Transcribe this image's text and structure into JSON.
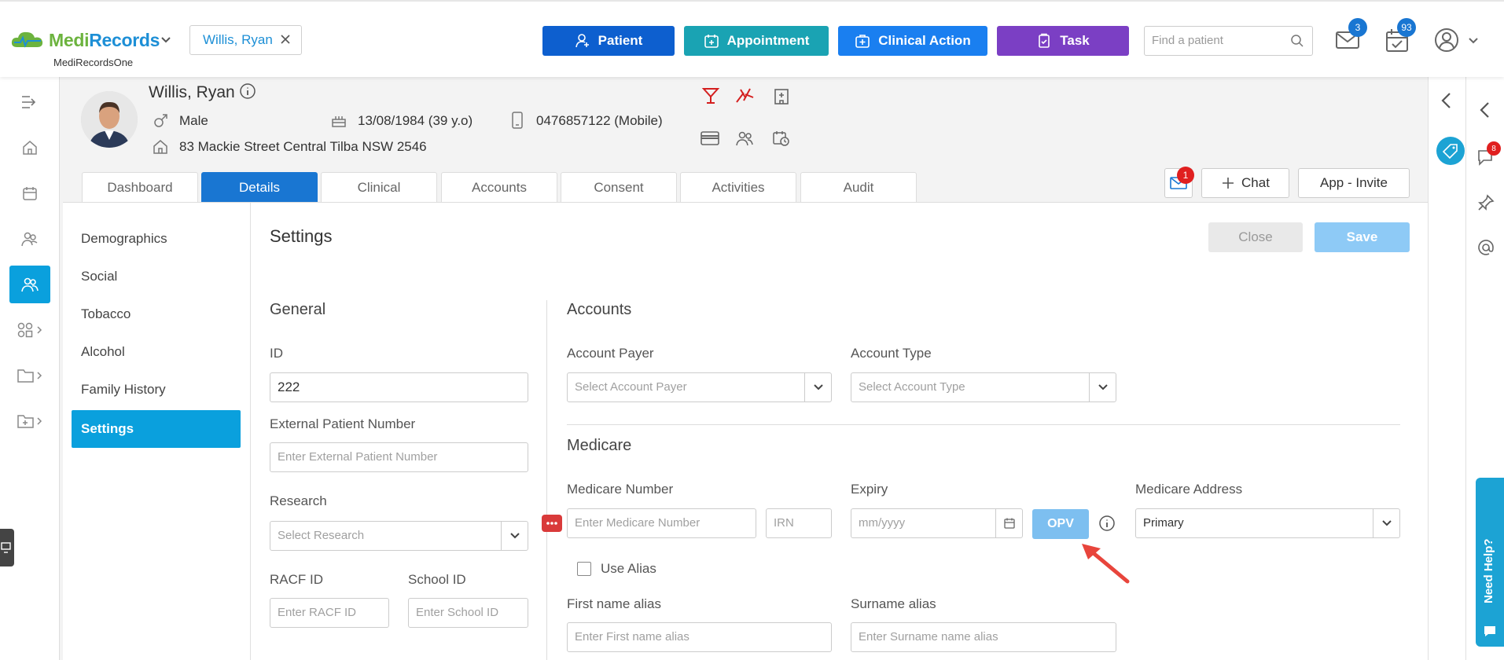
{
  "app": {
    "brand_medi": "Medi",
    "brand_records": "Records",
    "sub": "MediRecordsOne"
  },
  "header": {
    "patient_chip": "Willis, Ryan",
    "buttons": {
      "patient": "Patient",
      "appointment": "Appointment",
      "clinical_action": "Clinical Action",
      "task": "Task"
    },
    "search_placeholder": "Find a patient",
    "mail_badge": "3",
    "tasks_badge": "93",
    "colors": {
      "patient": "#0d5fcf",
      "appointment": "#1aa3b3",
      "clinical_action": "#1a7ff0",
      "task": "#7b3fc4"
    }
  },
  "patient": {
    "name": "Willis, Ryan",
    "gender": "Male",
    "dob": "13/08/1984 (39 y.o)",
    "phone": "0476857122 (Mobile)",
    "address": "83 Mackie Street Central Tilba NSW 2546"
  },
  "tabs": [
    "Dashboard",
    "Details",
    "Clinical",
    "Accounts",
    "Consent",
    "Activities",
    "Audit"
  ],
  "active_tab": "Details",
  "actions": {
    "message_badge": "1",
    "chat": "Chat",
    "app_invite": "App - Invite"
  },
  "menu": [
    "Demographics",
    "Social",
    "Tobacco",
    "Alcohol",
    "Family History",
    "Settings"
  ],
  "active_menu": "Settings",
  "settings": {
    "title": "Settings",
    "close": "Close",
    "save": "Save",
    "general": {
      "title": "General",
      "id_label": "ID",
      "id_value": "222",
      "ext_label": "External Patient Number",
      "ext_placeholder": "Enter External Patient Number",
      "research_label": "Research",
      "research_placeholder": "Select Research",
      "racf_label": "RACF ID",
      "racf_placeholder": "Enter RACF ID",
      "school_label": "School ID",
      "school_placeholder": "Enter School ID"
    },
    "accounts": {
      "title": "Accounts",
      "payer_label": "Account Payer",
      "payer_placeholder": "Select Account Payer",
      "type_label": "Account Type",
      "type_placeholder": "Select Account Type"
    },
    "medicare": {
      "title": "Medicare",
      "number_label": "Medicare Number",
      "number_placeholder": "Enter Medicare Number",
      "irn_placeholder": "IRN",
      "expiry_label": "Expiry",
      "expiry_placeholder": "mm/yyyy",
      "opv": "OPV",
      "address_label": "Medicare Address",
      "address_value": "Primary",
      "use_alias": "Use Alias",
      "first_alias_label": "First name alias",
      "first_alias_placeholder": "Enter First name alias",
      "surname_alias_label": "Surname alias",
      "surname_alias_placeholder": "Enter Surname name alias"
    }
  },
  "right_rail": {
    "chat_badge": "8",
    "need_help": "Need Help?"
  }
}
